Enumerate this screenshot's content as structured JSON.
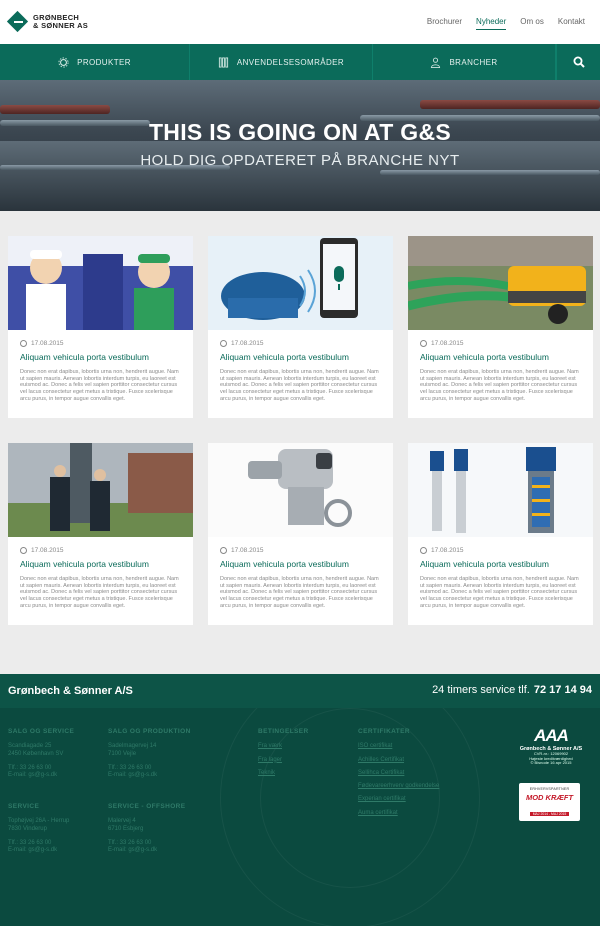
{
  "brand": {
    "line1": "GRØNBECH",
    "line2": "& SØNNER AS",
    "primary_color": "#0b6b5a",
    "footer_color": "#0b4a3f"
  },
  "topnav": [
    "Brochurer",
    "Nyheder",
    "Om os",
    "Kontakt"
  ],
  "topnav_active": "Nyheder",
  "mainnav": {
    "items": [
      {
        "label": "PRODUKTER",
        "icon": "gear-icon"
      },
      {
        "label": "ANVENDELSESOMRÅDER",
        "icon": "valve-icon"
      },
      {
        "label": "BRANCHER",
        "icon": "person-icon"
      }
    ],
    "search_icon": "search-icon"
  },
  "hero": {
    "title": "THIS IS GOING ON AT G&S",
    "subtitle": "HOLD DIG OPDATERET PÅ BRANCHE NYT"
  },
  "news": [
    {
      "date": "17.08.2015",
      "title": "Aliquam vehicula porta vestibulum",
      "image": "cartoon-engineers-illustration",
      "excerpt": "Donec non erat dapibus, lobortis urna non, hendrerit augue. Nam ut sapien mauris. Aenean lobortis interdum turpis, eu laoreet est euismod ac. Donec a felis vel sapien porttitor consectetur cursus vel lacus consectetur eget metus a tristique. Fusce scelerisque arcu purus, in tempor augue convallis eget."
    },
    {
      "date": "17.08.2015",
      "title": "Aliquam vehicula porta vestibulum",
      "image": "pump-and-smartphone-microphone",
      "excerpt": "Donec non erat dapibus, lobortis urna non, hendrerit augue. Nam ut sapien mauris. Aenean lobortis interdum turpis, eu laoreet est euismod ac. Donec a felis vel sapien porttitor consectetur cursus vel lacus consectetur eget metus a tristique. Fusce scelerisque arcu purus, in tempor augue convallis eget."
    },
    {
      "date": "17.08.2015",
      "title": "Aliquam vehicula porta vestibulum",
      "image": "yellow-mobile-pump-hoses",
      "excerpt": "Donec non erat dapibus, lobortis urna non, hendrerit augue. Nam ut sapien mauris. Aenean lobortis interdum turpis, eu laoreet est euismod ac. Donec a felis vel sapien porttitor consectetur cursus vel lacus consectetur eget metus a tristique. Fusce scelerisque arcu purus, in tempor augue convallis eget."
    },
    {
      "date": "17.08.2015",
      "title": "Aliquam vehicula porta vestibulum",
      "image": "two-men-outside-building",
      "excerpt": "Donec non erat dapibus, lobortis urna non, hendrerit augue. Nam ut sapien mauris. Aenean lobortis interdum turpis, eu laoreet est euismod ac. Donec a felis vel sapien porttitor consectetur cursus vel lacus consectetur eget metus a tristique. Fusce scelerisque arcu purus, in tempor augue convallis eget."
    },
    {
      "date": "17.08.2015",
      "title": "Aliquam vehicula porta vestibulum",
      "image": "valve-actuator",
      "excerpt": "Donec non erat dapibus, lobortis urna non, hendrerit augue. Nam ut sapien mauris. Aenean lobortis interdum turpis, eu laoreet est euismod ac. Donec a felis vel sapien porttitor consectetur cursus vel lacus consectetur eget metus a tristique. Fusce scelerisque arcu purus, in tempor augue convallis eget."
    },
    {
      "date": "17.08.2015",
      "title": "Aliquam vehicula porta vestibulum",
      "image": "vertical-multistage-pumps",
      "excerpt": "Donec non erat dapibus, lobortis urna non, hendrerit augue. Nam ut sapien mauris. Aenean lobortis interdum turpis, eu laoreet est euismod ac. Donec a felis vel sapien porttitor consectetur cursus vel lacus consectetur eget metus a tristique. Fusce scelerisque arcu purus, in tempor augue convallis eget."
    }
  ],
  "footer": {
    "company": "Grønbech & Sønner A/S",
    "service_text": "24 timers service tlf.",
    "service_phone": "72 17 14 94",
    "sales_service": {
      "heading": "SALG OG SERVICE",
      "address1": "Scandiagade 25",
      "address2": "2450 København SV",
      "phone": "Tlf.: 33 26 63 00",
      "email_prefix": "E-mail:",
      "email": "gs@g-s.dk"
    },
    "sales_production": {
      "heading": "SALG OG PRODUKTION",
      "address1": "Sadelmagervej 14",
      "address2": "7100 Vejle",
      "phone": "Tlf.: 33 26 63 00",
      "email_prefix": "E-mail:",
      "email": "gs@g-s.dk"
    },
    "service": {
      "heading": "SERVICE",
      "address1": "Tophøjvej 26A - Herrup",
      "address2": "7830 Vinderup",
      "phone": "Tlf.: 33 26 63 00",
      "email_prefix": "E-mail:",
      "email": "gs@g-s.dk"
    },
    "service_offshore": {
      "heading": "SERVICE - OFFSHORE",
      "address1": "Malervej 4",
      "address2": "6710 Esbjerg",
      "phone": "Tlf.: 33 26 63 00",
      "email_prefix": "E-mail:",
      "email": "gs@g-s.dk"
    },
    "conditions": {
      "heading": "BETINGELSER",
      "links": [
        "Fra værk",
        "Fra lager",
        "Teknik"
      ]
    },
    "certificates": {
      "heading": "CERTIFIKATER",
      "links": [
        "ISO certifikat",
        "Achilles Certifikat",
        "Sellihca Certifikat",
        "Fødevareerhverv godkendelse",
        "Experian certifikat",
        "Auma certifikat"
      ]
    },
    "aaa": {
      "rating": "AAA",
      "name": "Grønbech & Sønner A/S",
      "cvr": "CVR-nr.: 12069902",
      "line": "Højeste kreditværdighed",
      "date": "© Bisnode 16 apr 2015"
    },
    "badge": {
      "top": "ERHVERVSPARTNER",
      "main": "MOD KRÆFT",
      "years": "MAJ 2014 - MAJ 2015"
    }
  }
}
